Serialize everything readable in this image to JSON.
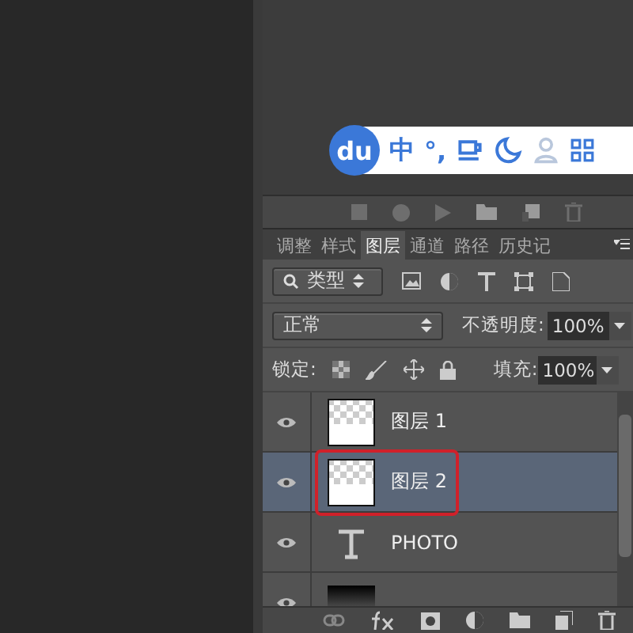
{
  "ime_bar": {
    "logo": "du",
    "mode": "中",
    "punctuation": "°,"
  },
  "tabs": [
    {
      "label": "调整",
      "selected": false
    },
    {
      "label": "样式",
      "selected": false
    },
    {
      "label": "图层",
      "selected": true
    },
    {
      "label": "通道",
      "selected": false
    },
    {
      "label": "路径",
      "selected": false
    },
    {
      "label": "历史记",
      "selected": false
    }
  ],
  "filter": {
    "value": "类型"
  },
  "blend_mode": {
    "value": "正常"
  },
  "opacity": {
    "label": "不透明度:",
    "value": "100%"
  },
  "lock": {
    "label": "锁定:"
  },
  "fill": {
    "label": "填充:",
    "value": "100%"
  },
  "layers": [
    {
      "kind": "pixel",
      "name": "图层 1",
      "visible": true,
      "selected": false,
      "annotated": false
    },
    {
      "kind": "pixel",
      "name": "图层 2",
      "visible": true,
      "selected": true,
      "annotated": true
    },
    {
      "kind": "text",
      "name": "PHOTO",
      "visible": true,
      "selected": false,
      "annotated": false
    },
    {
      "kind": "background",
      "visible": true,
      "selected": false,
      "annotated": false
    }
  ]
}
